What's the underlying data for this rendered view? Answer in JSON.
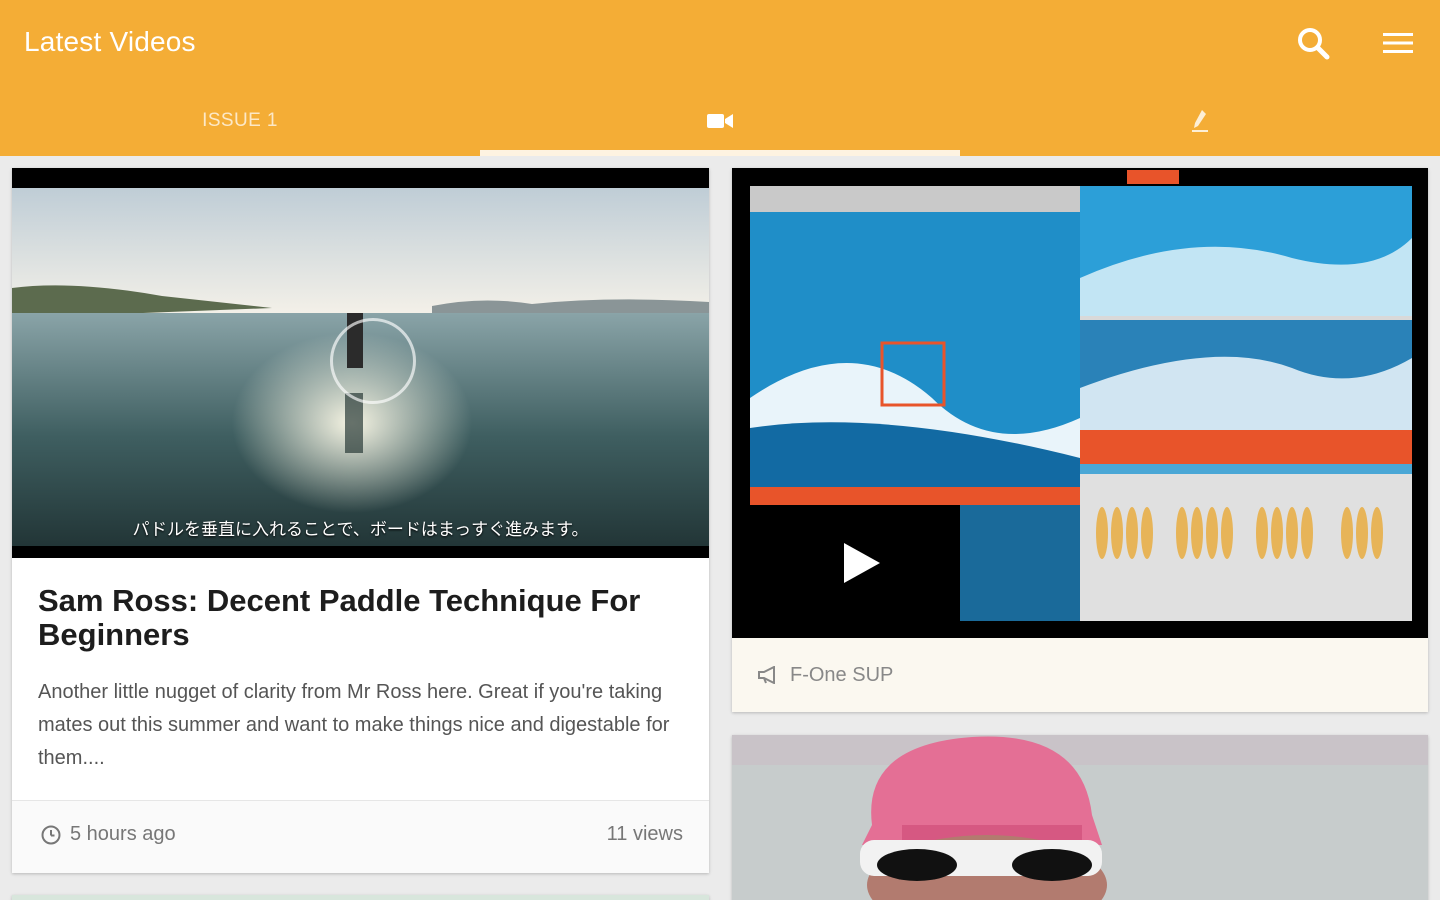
{
  "appbar": {
    "title": "Latest Videos",
    "background": "#f4ad36",
    "actions": [
      {
        "name": "search",
        "icon": "search-icon"
      },
      {
        "name": "menu",
        "icon": "hamburger-menu-icon"
      }
    ]
  },
  "tabs": [
    {
      "label": "ISSUE 1",
      "icon": null,
      "selected": false
    },
    {
      "label": "",
      "icon": "video-camera-icon",
      "selected": true
    },
    {
      "label": "",
      "icon": "pen-icon",
      "selected": false
    }
  ],
  "cards": {
    "left": {
      "subtitle_overlay": "パドルを垂直に入れることで、ボードはまっすぐ進みます。",
      "title": "Sam Ross: Decent Paddle Technique For Beginners",
      "excerpt": "Another little nugget of clarity from Mr Ross here. Great if you're taking mates out this summer and want to make things nice and digestable for them....",
      "time": "5 hours ago",
      "views": "11 views"
    },
    "right": {
      "sponsor_label": "F-One SUP",
      "icon": "megaphone-icon"
    }
  }
}
